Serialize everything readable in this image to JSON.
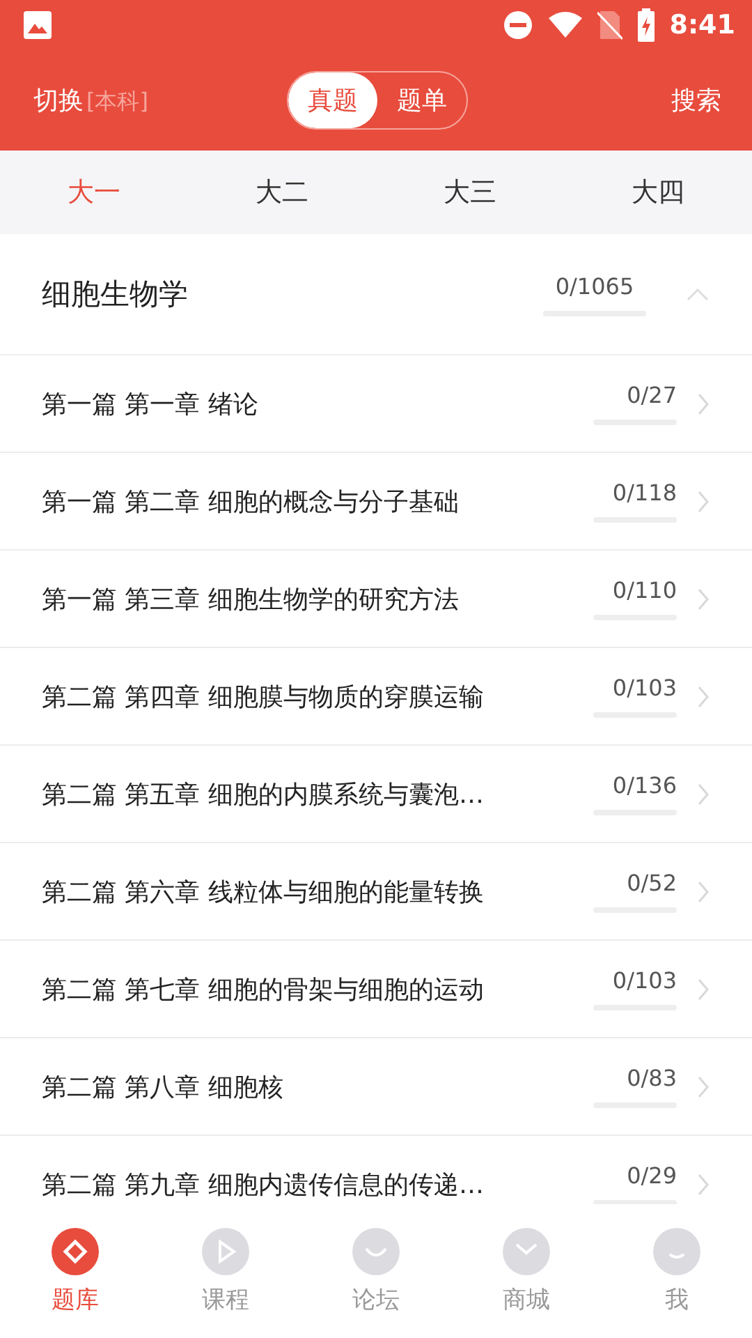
{
  "status_bar": {
    "time": "8:41"
  },
  "header": {
    "switch_label": "切换",
    "level_label": "[本科]",
    "search": "搜索",
    "toggle": [
      {
        "label": "真题",
        "selected": true
      },
      {
        "label": "题单",
        "selected": false
      }
    ]
  },
  "year_tabs": [
    {
      "label": "大一",
      "selected": true
    },
    {
      "label": "大二",
      "selected": false
    },
    {
      "label": "大三",
      "selected": false
    },
    {
      "label": "大四",
      "selected": false
    }
  ],
  "section": {
    "title": "细胞生物学",
    "count": "0/1065",
    "expanded": true
  },
  "chapters": [
    {
      "title": "第一篇 第一章 绪论",
      "count": "0/27"
    },
    {
      "title": "第一篇 第二章 细胞的概念与分子基础",
      "count": "0/118"
    },
    {
      "title": "第一篇 第三章 细胞生物学的研究方法",
      "count": "0/110"
    },
    {
      "title": "第二篇 第四章 细胞膜与物质的穿膜运输",
      "count": "0/103"
    },
    {
      "title": "第二篇 第五章 细胞的内膜系统与囊泡…",
      "count": "0/136"
    },
    {
      "title": "第二篇 第六章 线粒体与细胞的能量转换",
      "count": "0/52"
    },
    {
      "title": "第二篇 第七章 细胞的骨架与细胞的运动",
      "count": "0/103"
    },
    {
      "title": "第二篇 第八章 细胞核",
      "count": "0/83"
    },
    {
      "title": "第二篇 第九章 细胞内遗传信息的传递…",
      "count": "0/29"
    }
  ],
  "bottom_nav": [
    {
      "label": "题库",
      "kind": "bank",
      "selected": true
    },
    {
      "label": "课程",
      "kind": "course",
      "selected": false
    },
    {
      "label": "论坛",
      "kind": "forum",
      "selected": false
    },
    {
      "label": "商城",
      "kind": "shop",
      "selected": false
    },
    {
      "label": "我",
      "kind": "me",
      "selected": false
    }
  ]
}
